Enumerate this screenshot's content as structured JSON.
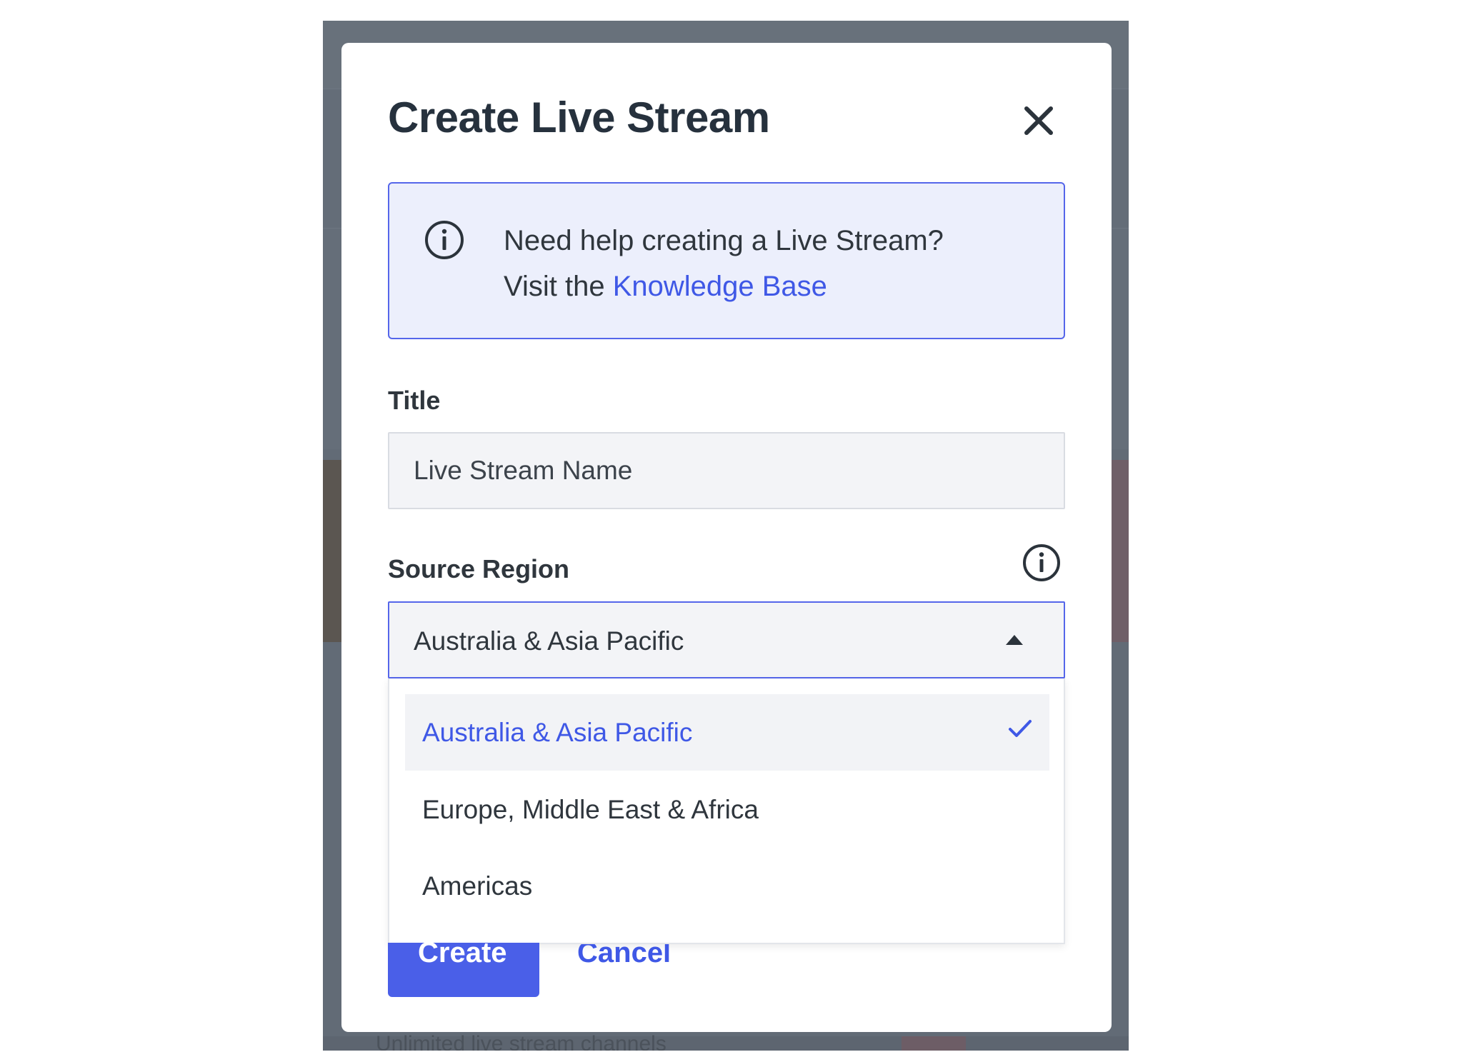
{
  "backdrop": {
    "bottom_text": "Unlimited live stream channels"
  },
  "modal": {
    "title": "Create Live Stream",
    "close_icon": "close-icon",
    "info": {
      "icon": "info-circle-icon",
      "line1": "Need help creating a Live Stream?",
      "line2_prefix": "Visit the ",
      "link_text": "Knowledge Base"
    },
    "title_field": {
      "label": "Title",
      "value": "",
      "placeholder": "Live Stream Name"
    },
    "source_region": {
      "label": "Source Region",
      "info_icon": "info-circle-icon",
      "selected_value": "Australia & Asia Pacific",
      "expanded": true,
      "options": [
        {
          "label": "Australia & Asia Pacific",
          "selected": true
        },
        {
          "label": "Europe, Middle East & Africa",
          "selected": false
        },
        {
          "label": "Americas",
          "selected": false
        }
      ]
    },
    "actions": {
      "create_label": "Create",
      "cancel_label": "Cancel"
    }
  },
  "colors": {
    "accent": "#4a5fe8",
    "link": "#3f58e6",
    "info_bg": "#eceffc",
    "backdrop": "#626b76"
  }
}
